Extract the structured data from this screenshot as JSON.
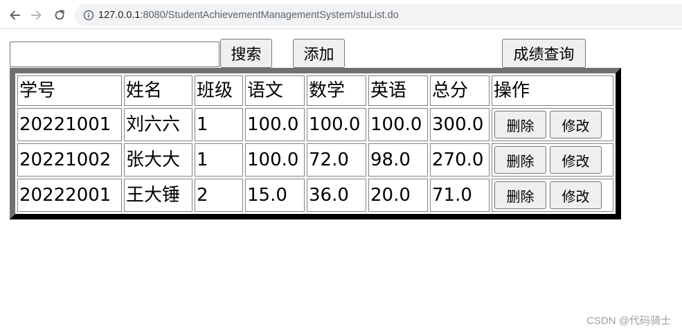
{
  "browser": {
    "url_host": "127.0.0.1",
    "url_path": ":8080/StudentAchievementManagementSystem/stuList.do"
  },
  "toolbar": {
    "search_value": "",
    "search_label": "搜索",
    "add_label": "添加",
    "query_label": "成绩查询"
  },
  "table": {
    "headers": [
      "学号",
      "姓名",
      "班级",
      "语文",
      "数学",
      "英语",
      "总分",
      "操作"
    ],
    "rows": [
      {
        "id": "20221001",
        "name": "刘六六",
        "class": "1",
        "chinese": "100.0",
        "math": "100.0",
        "english": "100.0",
        "total": "300.0"
      },
      {
        "id": "20221002",
        "name": "张大大",
        "class": "1",
        "chinese": "100.0",
        "math": "72.0",
        "english": "98.0",
        "total": "270.0"
      },
      {
        "id": "20222001",
        "name": "王大锤",
        "class": "2",
        "chinese": "15.0",
        "math": "36.0",
        "english": "20.0",
        "total": "71.0"
      }
    ],
    "delete_label": "删除",
    "modify_label": "修改"
  },
  "watermark": "CSDN @代码骑士"
}
